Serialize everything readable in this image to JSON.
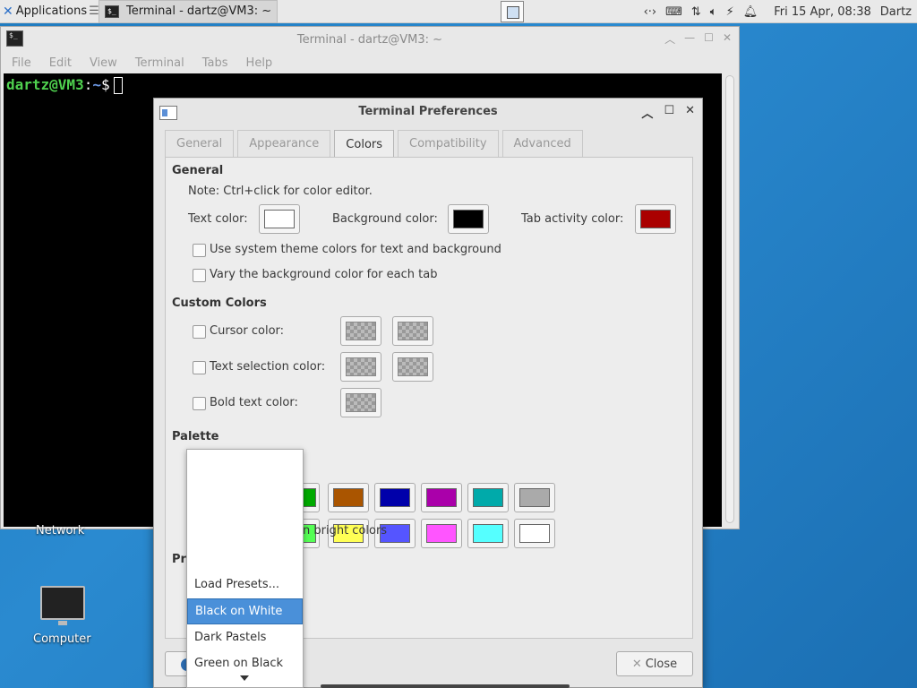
{
  "panel": {
    "apps_label": "Applications",
    "apps_suffix": "☰",
    "task_label": "Terminal - dartz@VM3: ~",
    "clock": "Fri 15 Apr, 08:38",
    "user": "Dartz",
    "tray_icons": [
      "network-icon",
      "keyboard-icon",
      "transfer-icon",
      "volume-icon",
      "power-icon",
      "notification-icon"
    ]
  },
  "terminal": {
    "title": "Terminal - dartz@VM3: ~",
    "menu": [
      "File",
      "Edit",
      "View",
      "Terminal",
      "Tabs",
      "Help"
    ],
    "prompt_user": "dartz@VM3",
    "prompt_sep": ":",
    "prompt_path": "~",
    "prompt_sym": "$"
  },
  "desktop": {
    "network_label": "Network",
    "computer_label": "Computer"
  },
  "prefs": {
    "title": "Terminal Preferences",
    "tabs": [
      "General",
      "Appearance",
      "Colors",
      "Compatibility",
      "Advanced"
    ],
    "active_tab": "Colors",
    "general": {
      "heading": "General",
      "note": "Note: Ctrl+click for color editor.",
      "text_color_label": "Text color:",
      "bg_color_label": "Background color:",
      "tab_activity_label": "Tab activity color:",
      "text_color": "#ffffff",
      "bg_color": "#000000",
      "tab_activity_color": "#aa0000",
      "use_system": "Use system theme colors for text and background",
      "vary_bg": "Vary the background color for each tab"
    },
    "custom": {
      "heading": "Custom Colors",
      "cursor": "Cursor color:",
      "selection": "Text selection color:",
      "bold": "Bold text color:"
    },
    "palette": {
      "heading": "Palette",
      "row1": [
        "#00aa00",
        "#aa5500",
        "#0000aa",
        "#aa00aa",
        "#00aaaa",
        "#aaaaaa"
      ],
      "row2": [
        "#55ff55",
        "#ffff55",
        "#5555ff",
        "#ff55ff",
        "#55ffff",
        "#ffffff"
      ],
      "bright_text": "n bright colors"
    },
    "presets_partial": "Pr",
    "close_label": "Close"
  },
  "dropdown": {
    "items": [
      "Load Presets...",
      "Black on White",
      "Dark Pastels",
      "Green on Black"
    ],
    "selected": "Black on White"
  }
}
